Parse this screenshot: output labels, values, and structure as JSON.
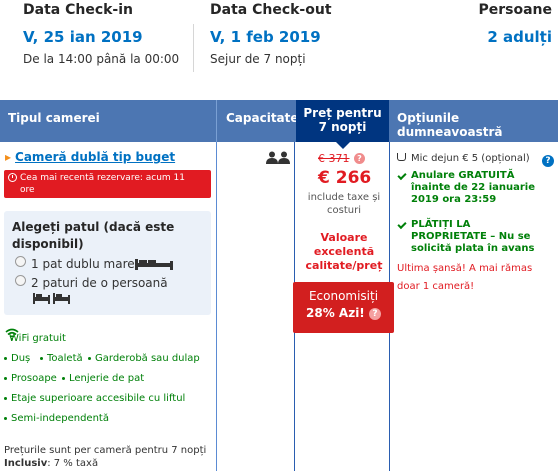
{
  "dates": {
    "checkin": {
      "label": "Data Check-in",
      "value": "V, 25 ian 2019",
      "sub": "De la 14:00 până la 00:00"
    },
    "checkout": {
      "label": "Data Check-out",
      "value": "V, 1 feb 2019",
      "sub": "Sejur de 7 nopți"
    },
    "guests": {
      "label": "Persoane",
      "value": "2 adulți"
    }
  },
  "table": {
    "headers": {
      "room": "Tipul camerei",
      "capacity": "Capacitate",
      "price_line1": "Preț pentru",
      "price_line2": "7 nopți",
      "options": "Opțiunile dumneavoastră"
    }
  },
  "room": {
    "title": "Cameră dublă tip buget",
    "recent_line1": "Cea mai recentă rezervare: acum 11",
    "recent_line2": "ore",
    "bed_heading": "Alegeți patul (dacă este disponibil)",
    "bed_options": [
      "1 pat dublu mare",
      "2 paturi de o persoană"
    ],
    "wifi": "WiFi gratuit",
    "facilities": [
      "Duș",
      "Toaletă",
      "Garderobă sau dulap",
      "Prosoape",
      "Lenjerie de pat",
      "Etaje superioare accesibile cu liftul",
      "Semi-independentă"
    ],
    "note_line1": "Prețurile sunt per cameră pentru 7 nopți",
    "note_bold": "Inclusiv",
    "note_rest": ": 7 % taxă"
  },
  "price": {
    "old": "€ 371",
    "new": "€ 266",
    "taxes": "include taxe și costuri",
    "value_tag": "Valoare excelentă calitate/preț",
    "save_line1": "Economisiți",
    "save_line2": "28% Azi!"
  },
  "options": {
    "breakfast": "Mic dejun € 5 (opțional)",
    "cancel_line1": "Anulare GRATUITĂ",
    "cancel_line2": "înainte de 22 ianuarie",
    "cancel_line3": "2019 ora 23:59",
    "pay_line1": "PLĂTIȚI LA",
    "pay_line2": "PROPRIETATE – Nu se",
    "pay_line3": "solicită plata în avans",
    "last_chance": "Ultima șansă! A mai rămas doar 1 cameră!"
  },
  "colors": {
    "header_bg": "#4c76b2",
    "price_header_bg": "#003580",
    "link_blue": "#0071c2",
    "red": "#e11b22",
    "green": "#008009"
  }
}
